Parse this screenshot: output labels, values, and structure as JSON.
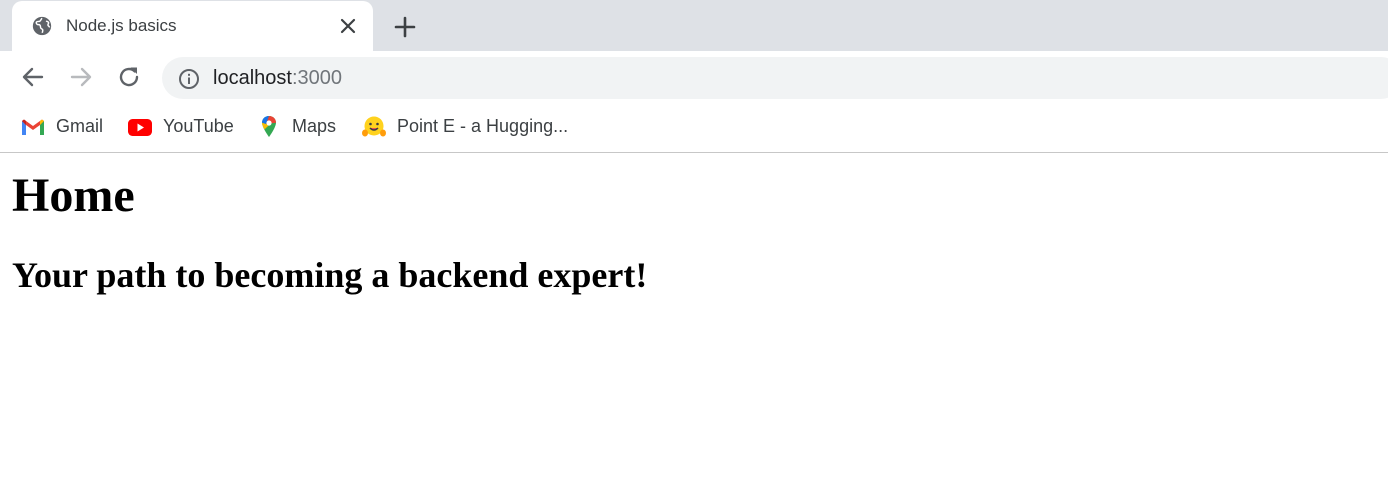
{
  "browser": {
    "tabs": [
      {
        "title": "Node.js basics",
        "icon": "globe-icon",
        "active": true
      }
    ],
    "new_tab_icon": "plus-icon",
    "toolbar": {
      "back_icon": "arrow-left-icon",
      "forward_icon": "arrow-right-icon",
      "reload_icon": "reload-icon",
      "site_info_icon": "info-icon",
      "url_host": "localhost",
      "url_port": ":3000"
    },
    "bookmarks": [
      {
        "label": "Gmail",
        "icon": "gmail-icon"
      },
      {
        "label": "YouTube",
        "icon": "youtube-icon"
      },
      {
        "label": "Maps",
        "icon": "maps-icon"
      },
      {
        "label": "Point E - a Hugging...",
        "icon": "hugging-face-icon"
      }
    ]
  },
  "page": {
    "heading": "Home",
    "subheading": "Your path to becoming a backend expert!"
  },
  "colors": {
    "tabstrip_bg": "#dee1e6",
    "omnibox_bg": "#f1f3f4",
    "icon_gray": "#5f6368",
    "youtube_red": "#ff0000"
  }
}
